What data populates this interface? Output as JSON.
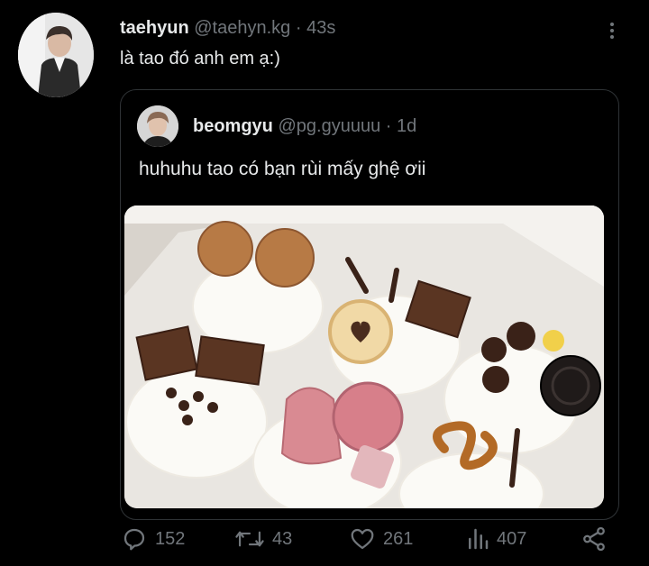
{
  "tweet": {
    "display_name": "taehyun",
    "handle": "@taehyn.kg",
    "separator": "·",
    "time": "43s",
    "text": "là tao đó anh em ạ:)"
  },
  "quoted_tweet": {
    "display_name": "beomgyu",
    "handle": "@pg.gyuuuu",
    "separator": "·",
    "time": "1d",
    "text": "huhuhu tao có bạn rùi mấy ghệ ơii"
  },
  "actions": {
    "replies": "152",
    "retweets": "43",
    "likes": "261",
    "views": "407"
  },
  "icons": [
    "more-icon",
    "reply-icon",
    "retweet-icon",
    "like-icon",
    "views-icon",
    "share-icon"
  ],
  "colors": {
    "background": "#000000",
    "text": "#e7e9ea",
    "muted": "#71767b",
    "border": "#2f3336"
  }
}
